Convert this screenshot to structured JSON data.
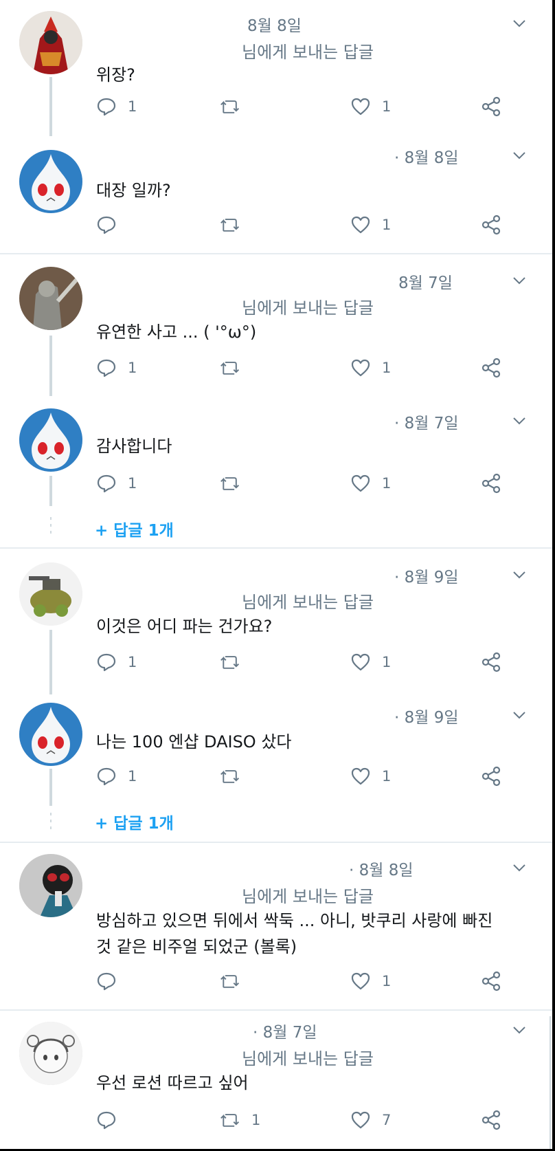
{
  "tweets": [
    {
      "date": "8월 8일",
      "replying_to": "님에게 보내는 답글",
      "text": "위장?",
      "reply_count": "1",
      "retweet_count": "",
      "like_count": "1",
      "show_replying": true
    },
    {
      "date": "· 8월 8일",
      "replying_to": "",
      "text": "대장 일까?",
      "reply_count": "",
      "retweet_count": "",
      "like_count": "1",
      "show_replying": false
    },
    {
      "date": "8월 7일",
      "replying_to": "님에게 보내는 답글",
      "text": "유연한 사고 ... ( '°ω°)",
      "reply_count": "1",
      "retweet_count": "",
      "like_count": "1",
      "show_replying": true
    },
    {
      "date": "· 8월 7일",
      "replying_to": "",
      "text": "감사합니다",
      "reply_count": "1",
      "retweet_count": "",
      "like_count": "1",
      "show_replying": false,
      "more_replies": "+ 답글 1개"
    },
    {
      "date": "· 8월 9일",
      "replying_to": "님에게 보내는 답글",
      "text": "이것은 어디 파는 건가요?",
      "reply_count": "1",
      "retweet_count": "",
      "like_count": "1",
      "show_replying": true
    },
    {
      "date": "· 8월 9일",
      "replying_to": "",
      "text": "나는 100 엔샵 DAISO 샀다",
      "reply_count": "1",
      "retweet_count": "",
      "like_count": "1",
      "show_replying": false,
      "more_replies": "+ 답글 1개"
    },
    {
      "date": "· 8월 8일",
      "replying_to": "님에게 보내는 답글",
      "text_line1": "방심하고 있으면 뒤에서 싹둑 ... 아니, 밧쿠리 사랑에 빠진",
      "text_line2": "것 같은 비주얼 되었군 (볼록)",
      "reply_count": "",
      "retweet_count": "",
      "like_count": "1",
      "show_replying": true
    },
    {
      "date": "· 8월 7일",
      "replying_to": "님에게 보내는 답글",
      "text": "우선 로션 따르고 싶어",
      "reply_count": "",
      "retweet_count": "1",
      "like_count": "7",
      "show_replying": true
    }
  ],
  "icons": {
    "reply": "reply-icon",
    "retweet": "retweet-icon",
    "like": "like-icon",
    "share": "share-icon",
    "more": "chevron-down-icon"
  },
  "colors": {
    "text": "#14171a",
    "muted": "#657786",
    "link": "#1da1f2",
    "divider": "#e6ecf0",
    "thread_line": "#cfd9de"
  }
}
